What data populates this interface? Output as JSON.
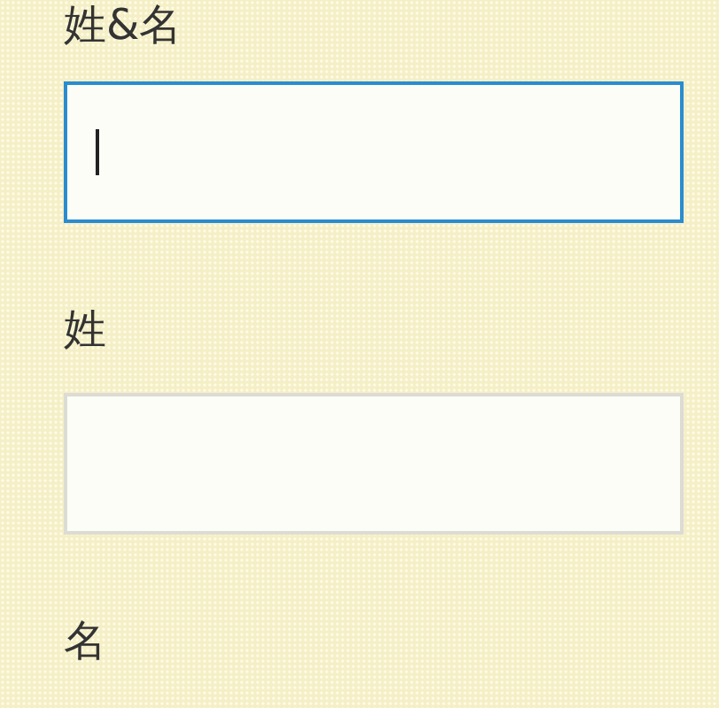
{
  "fields": [
    {
      "label": "姓&名",
      "input": {
        "focused": true
      }
    },
    {
      "label": "姓",
      "input": {
        "focused": false
      }
    },
    {
      "label": "名"
    }
  ]
}
